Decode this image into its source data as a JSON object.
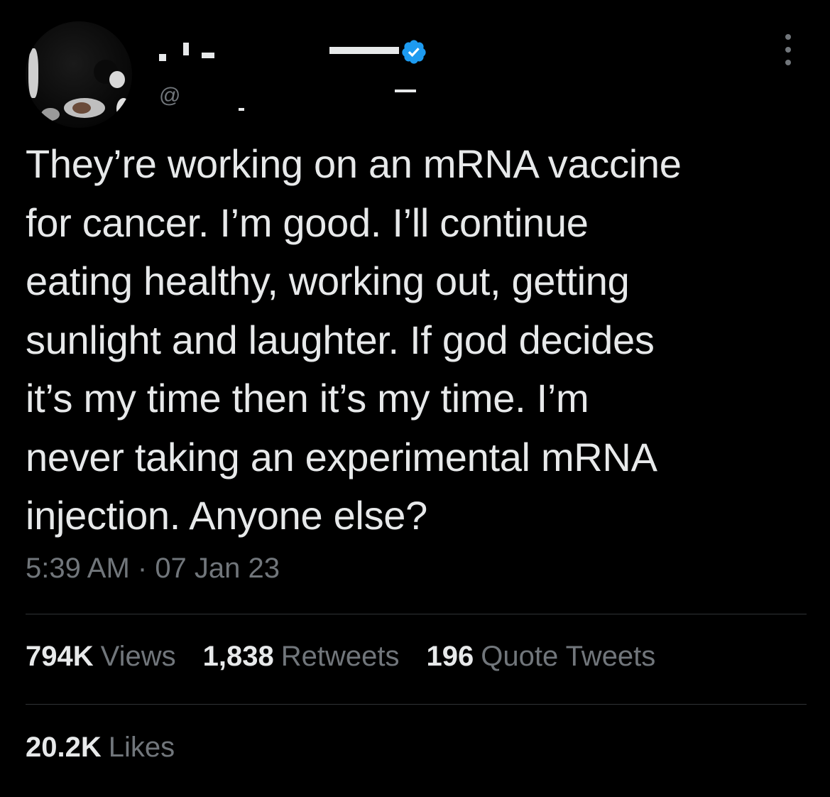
{
  "account": {
    "handle_prefix": "@",
    "verified_icon": "verified-badge-icon",
    "avatar_icon": "avatar"
  },
  "tweet": {
    "text": "They’re working on an mRNA vaccine\nfor cancer. I’m good. I’ll continue\neating healthy, working out, getting\nsunlight and laughter. If god decides\nit’s my time then it’s my time. I’m\nnever taking an experimental mRNA\ninjection. Anyone else?",
    "time": "5:39 AM",
    "separator": " · ",
    "date": "07 Jan 23"
  },
  "stats": {
    "views": {
      "count": "794K",
      "label": "Views"
    },
    "retweets": {
      "count": "1,838",
      "label": "Retweets"
    },
    "quote_tweets": {
      "count": "196",
      "label": "Quote Tweets"
    },
    "likes": {
      "count": "20.2K",
      "label": "Likes"
    }
  },
  "colors": {
    "background": "#000000",
    "text_primary": "#e7e9ea",
    "text_secondary": "#71767b",
    "divider": "#2f3336",
    "verified_blue": "#1d9bf0"
  }
}
